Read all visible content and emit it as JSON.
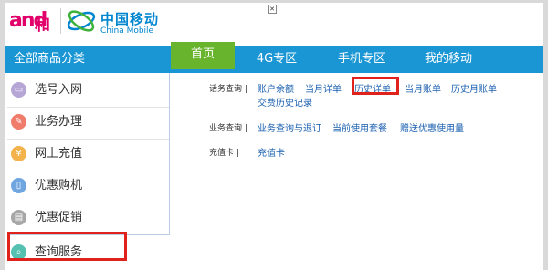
{
  "header": {
    "and_logo_text": "and",
    "and_logo_char": "和",
    "brand_cn": "中国移动",
    "brand_en": "China Mobile",
    "close_glyph": "✕"
  },
  "nav": {
    "category_title": "全部商品分类",
    "tabs": [
      {
        "label": "首页",
        "active": true
      },
      {
        "label": "4G专区",
        "active": false
      },
      {
        "label": "手机专区",
        "active": false
      },
      {
        "label": "我的移动",
        "active": false
      }
    ]
  },
  "sidebar": {
    "items": [
      {
        "label": "选号入网",
        "icon": "card-icon",
        "color": "#b6a6d6",
        "glyph": "▭"
      },
      {
        "label": "业务办理",
        "icon": "pencil-icon",
        "color": "#f07c6c",
        "glyph": "✎"
      },
      {
        "label": "网上充值",
        "icon": "yen-icon",
        "color": "#f3b24a",
        "glyph": "¥"
      },
      {
        "label": "优惠购机",
        "icon": "phone-icon",
        "color": "#6fa6e0",
        "glyph": "▯"
      },
      {
        "label": "优惠促销",
        "icon": "ticket-icon",
        "color": "#a7a7a7",
        "glyph": "▤"
      },
      {
        "label": "查询服务",
        "icon": "search-icon",
        "color": "#55c2b1",
        "glyph": "⌕"
      }
    ]
  },
  "content": {
    "rows": [
      {
        "label": "话务查询 |",
        "links": [
          "账户余额",
          "当月详单",
          "历史详单",
          "当月账单",
          "历史月账单",
          "交费历史记录"
        ]
      },
      {
        "label": "业务查询 |",
        "links": [
          "业务查询与退订",
          "当前使用套餐",
          "赠送优惠使用量"
        ]
      },
      {
        "label": "充值卡 |",
        "links": [
          "充值卡"
        ]
      }
    ]
  },
  "colors": {
    "nav_blue": "#1a96d4",
    "active_green": "#68b52d",
    "highlight_red": "#e0221d",
    "link_blue": "#1a5fb0"
  }
}
